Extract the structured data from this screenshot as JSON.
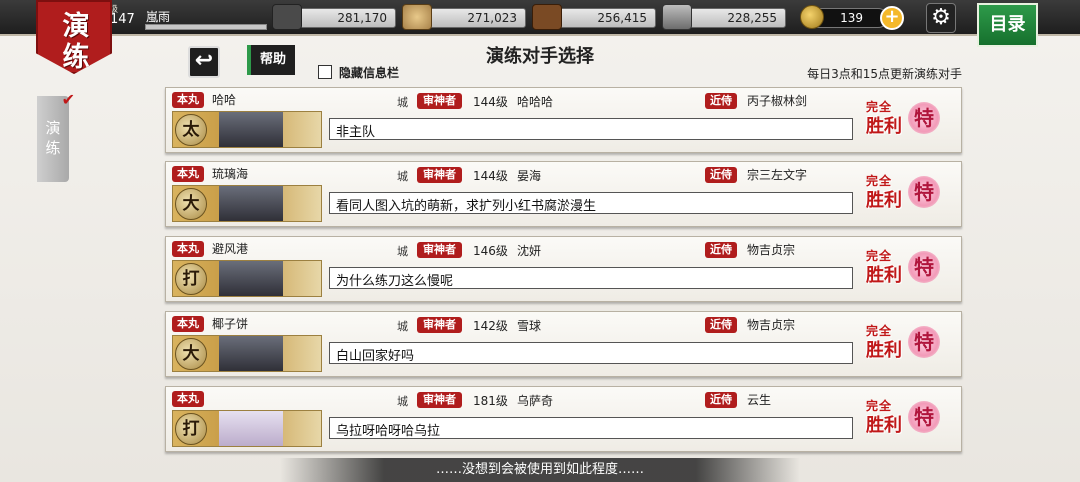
{
  "header": {
    "seal_line1": "演",
    "seal_line2": "练",
    "level_label": "等级",
    "level": "147",
    "player_name": "嵐雨",
    "resources": [
      {
        "name": "charcoal",
        "value": "281,170",
        "icon": "charcoal-icon",
        "color": "#4a4a4a"
      },
      {
        "name": "steel",
        "value": "271,023",
        "icon": "steel-icon",
        "color": "#a8824a"
      },
      {
        "name": "coolant",
        "value": "256,415",
        "icon": "coolant-icon",
        "color": "#7a4a24"
      },
      {
        "name": "whetstone",
        "value": "228,255",
        "icon": "whetstone-icon",
        "color": "#8d8d8d"
      }
    ],
    "coins": "139",
    "plus": "+",
    "settings_icon": "⚙",
    "menu_label": "目录"
  },
  "sidebar": {
    "tab_label": "演练",
    "check": "✔"
  },
  "toolbar": {
    "back_icon": "↩",
    "help_label": "帮助",
    "hide_info_label": "隐藏信息栏",
    "title": "演练对手选择",
    "notice": "每日3点和15点更新演练对手"
  },
  "labels": {
    "honmaru": "本丸",
    "castle": "城",
    "saniwa": "审神者",
    "kinji": "近侍",
    "win_top": "完全",
    "win_main": "胜利",
    "win_badge": "特"
  },
  "opponents": [
    {
      "honmaru_name": "哈哈",
      "level": "144级",
      "saniwa": "哈哈哈",
      "kinji": "丙子椒林剑",
      "message": "非主队",
      "type": "太"
    },
    {
      "honmaru_name": "琉璃海",
      "level": "144级",
      "saniwa": "晏海",
      "kinji": "宗三左文字",
      "message": "看同人图入坑的萌新，求扩列小红书腐淤漫生",
      "type": "大"
    },
    {
      "honmaru_name": "避风港",
      "level": "146级",
      "saniwa": "沈妍",
      "kinji": "物吉贞宗",
      "message": "为什么练刀这么慢呢",
      "type": "打"
    },
    {
      "honmaru_name": "椰子饼",
      "level": "142级",
      "saniwa": "雪球",
      "kinji": "物吉贞宗",
      "message": "白山回家好吗",
      "type": "大"
    },
    {
      "honmaru_name": "",
      "level": "181级",
      "saniwa": "乌萨奇",
      "kinji": "云生",
      "message": "乌拉呀哈呀哈乌拉",
      "type": "打"
    }
  ],
  "footer": {
    "text": "……没想到会被使用到如此程度……"
  },
  "colors": {
    "accent_red": "#b01d1d",
    "menu_green": "#2e9a4a",
    "win_red": "#c01818"
  }
}
